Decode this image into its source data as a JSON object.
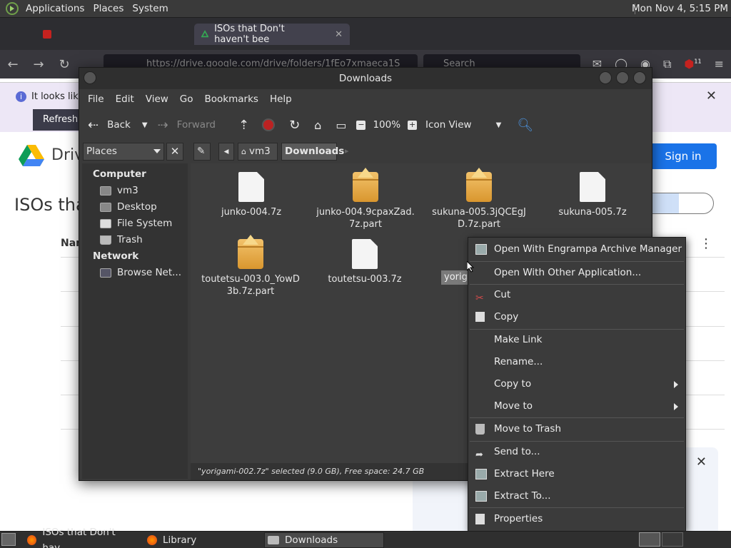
{
  "top_panel": {
    "menus": [
      "Applications",
      "Places",
      "System"
    ],
    "clock": "Mon Nov  4,  5:15 PM"
  },
  "browser": {
    "tabs": [
      {
        "label": "ISOs that Don't haven't bee"
      }
    ],
    "url": "https://drive.google.com/drive/folders/1fEo7xmaeca1S",
    "search_placeholder": "Search",
    "badge_count": "11",
    "banner_text": "It looks like",
    "banner_button": "Refresh",
    "drive_label": "Driv",
    "page_title": "ISOs tha",
    "signin": "Sign in",
    "column_name": "Nam"
  },
  "file_manager": {
    "title": "Downloads",
    "menu": [
      "File",
      "Edit",
      "View",
      "Go",
      "Bookmarks",
      "Help"
    ],
    "toolbar": {
      "back": "Back",
      "forward": "Forward",
      "zoom": "100%",
      "view_mode": "Icon View"
    },
    "places_combo": "Places",
    "breadcrumbs": [
      "vm3",
      "Downloads"
    ],
    "sidebar": {
      "computer_heading": "Computer",
      "computer_items": [
        "vm3",
        "Desktop",
        "File System",
        "Trash"
      ],
      "network_heading": "Network",
      "network_items": [
        "Browse Net..."
      ]
    },
    "files": [
      {
        "name": "junko-004.7z",
        "type": "doc"
      },
      {
        "name": "junko-004.9cpaxZad.7z.part",
        "type": "pkg"
      },
      {
        "name": "sukuna-005.3jQCEgJD.7z.part",
        "type": "pkg"
      },
      {
        "name": "sukuna-005.7z",
        "type": "doc"
      },
      {
        "name": "toutetsu-003.0_YowD3b.7z.part",
        "type": "pkg"
      },
      {
        "name": "toutetsu-003.7z",
        "type": "doc"
      }
    ],
    "selected_label": "yoriga",
    "status": "\"yorigami-002.7z\" selected (9.0 GB), Free space: 24.7 GB"
  },
  "context_menu": {
    "items": [
      "Open With Engrampa Archive Manager",
      "Open With Other Application...",
      "Cut",
      "Copy",
      "Make Link",
      "Rename...",
      "Copy to",
      "Move to",
      "Move to Trash",
      "Send to...",
      "Extract Here",
      "Extract To...",
      "Properties"
    ]
  },
  "taskbar": {
    "tasks": [
      "ISOs that Don't hav...",
      "Library",
      "Downloads"
    ]
  },
  "colors": {
    "accent": "#1a73e8",
    "cut_icon": "#d14b4b"
  }
}
